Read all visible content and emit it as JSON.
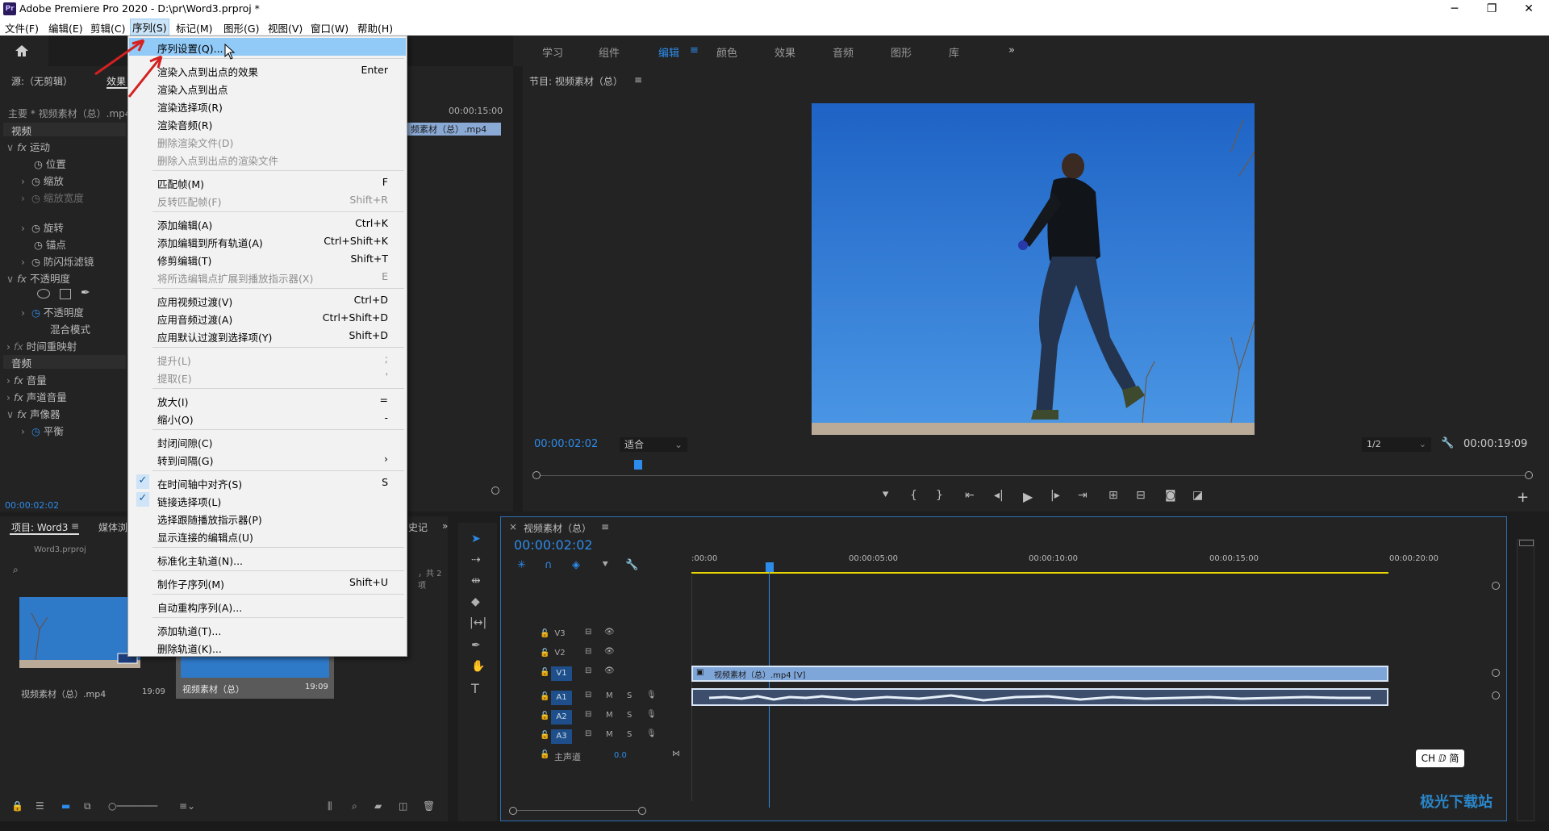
{
  "window": {
    "title": "Adobe Premiere Pro 2020 - D:\\pr\\Word3.prproj *",
    "icon": "Pr",
    "min": "─",
    "max": "❐",
    "close": "✕"
  },
  "menubar": [
    "文件(F)",
    "编辑(E)",
    "剪辑(C)",
    "序列(S)",
    "标记(M)",
    "图形(G)",
    "视图(V)",
    "窗口(W)",
    "帮助(H)"
  ],
  "workspaces": {
    "items": [
      "学习",
      "组件",
      "编辑",
      "颜色",
      "效果",
      "音频",
      "图形",
      "库"
    ],
    "active": "编辑",
    "more": "»"
  },
  "source_tabs": {
    "source": "源:（无剪辑）",
    "effects": "效果"
  },
  "effect_controls": {
    "clip": "主要 * 视频素材（总）.mp4",
    "time_ruler": "00:00:15:00",
    "clip_bar": "频素材（总）.mp4",
    "video_header": "视频",
    "rows": [
      {
        "label": "运动",
        "type": "fx"
      },
      {
        "label": "位置",
        "type": "prop"
      },
      {
        "label": "缩放",
        "type": "prop"
      },
      {
        "label": "缩放宽度",
        "type": "prop-dis"
      },
      {
        "label": "旋转",
        "type": "prop"
      },
      {
        "label": "锚点",
        "type": "prop"
      },
      {
        "label": "防闪烁滤镜",
        "type": "prop"
      },
      {
        "label": "不透明度",
        "type": "fx"
      },
      {
        "label": "不透明度",
        "type": "prop"
      },
      {
        "label": "混合模式",
        "type": "prop"
      },
      {
        "label": "时间重映射",
        "type": "fx"
      }
    ],
    "audio_header": "音频",
    "audio_rows": [
      {
        "label": "音量",
        "type": "fx"
      },
      {
        "label": "声道音量",
        "type": "fx"
      },
      {
        "label": "声像器",
        "type": "fx"
      },
      {
        "label": "平衡",
        "type": "prop"
      }
    ],
    "timecode": "00:00:02:02"
  },
  "sequence_menu": [
    {
      "label": "序列设置(Q)...",
      "shortcut": "",
      "state": "highlight"
    },
    {
      "label": "渲染入点到出点的效果",
      "shortcut": "Enter",
      "state": "normal",
      "sep_before": true
    },
    {
      "label": "渲染入点到出点",
      "shortcut": "",
      "state": "normal"
    },
    {
      "label": "渲染选择项(R)",
      "shortcut": "",
      "state": "normal"
    },
    {
      "label": "渲染音频(R)",
      "shortcut": "",
      "state": "normal"
    },
    {
      "label": "删除渲染文件(D)",
      "shortcut": "",
      "state": "disabled"
    },
    {
      "label": "删除入点到出点的渲染文件",
      "shortcut": "",
      "state": "disabled"
    },
    {
      "label": "匹配帧(M)",
      "shortcut": "F",
      "state": "normal",
      "sep_before": true
    },
    {
      "label": "反转匹配帧(F)",
      "shortcut": "Shift+R",
      "state": "disabled"
    },
    {
      "label": "添加编辑(A)",
      "shortcut": "Ctrl+K",
      "state": "normal",
      "sep_before": true
    },
    {
      "label": "添加编辑到所有轨道(A)",
      "shortcut": "Ctrl+Shift+K",
      "state": "normal"
    },
    {
      "label": "修剪编辑(T)",
      "shortcut": "Shift+T",
      "state": "normal"
    },
    {
      "label": "将所选编辑点扩展到播放指示器(X)",
      "shortcut": "E",
      "state": "disabled"
    },
    {
      "label": "应用视频过渡(V)",
      "shortcut": "Ctrl+D",
      "state": "normal",
      "sep_before": true
    },
    {
      "label": "应用音频过渡(A)",
      "shortcut": "Ctrl+Shift+D",
      "state": "normal"
    },
    {
      "label": "应用默认过渡到选择项(Y)",
      "shortcut": "Shift+D",
      "state": "normal"
    },
    {
      "label": "提升(L)",
      "shortcut": ";",
      "state": "disabled",
      "sep_before": true
    },
    {
      "label": "提取(E)",
      "shortcut": "'",
      "state": "disabled"
    },
    {
      "label": "放大(I)",
      "shortcut": "=",
      "state": "normal",
      "sep_before": true
    },
    {
      "label": "缩小(O)",
      "shortcut": "-",
      "state": "normal"
    },
    {
      "label": "封闭间隙(C)",
      "shortcut": "",
      "state": "normal",
      "sep_before": true
    },
    {
      "label": "转到间隔(G)",
      "shortcut": "›",
      "state": "normal"
    },
    {
      "label": "在时间轴中对齐(S)",
      "shortcut": "S",
      "state": "checked",
      "sep_before": true
    },
    {
      "label": "链接选择项(L)",
      "shortcut": "",
      "state": "checked"
    },
    {
      "label": "选择跟随播放指示器(P)",
      "shortcut": "",
      "state": "normal"
    },
    {
      "label": "显示连接的编辑点(U)",
      "shortcut": "",
      "state": "normal"
    },
    {
      "label": "标准化主轨道(N)...",
      "shortcut": "",
      "state": "normal",
      "sep_before": true
    },
    {
      "label": "制作子序列(M)",
      "shortcut": "Shift+U",
      "state": "normal",
      "sep_before": true
    },
    {
      "label": "自动重构序列(A)...",
      "shortcut": "",
      "state": "normal",
      "sep_before": true
    },
    {
      "label": "添加轨道(T)...",
      "shortcut": "",
      "state": "normal",
      "sep_before": true
    },
    {
      "label": "删除轨道(K)...",
      "shortcut": "",
      "state": "normal"
    }
  ],
  "program": {
    "title": "节目: 视频素材（总）",
    "timecode": "00:00:02:02",
    "fit": "适合",
    "resolution": "1/2",
    "duration": "00:00:19:09"
  },
  "project": {
    "tab": "项目: Word3",
    "tab2": "媒体浏",
    "tab3": "史记",
    "file": "Word3.prproj",
    "count": "，共 2 项",
    "items": [
      {
        "name": "视频素材（总）.mp4",
        "dur": "19:09"
      },
      {
        "name": "视频素材（总）",
        "dur": "19:09"
      }
    ]
  },
  "timeline": {
    "tab": "视频素材（总）",
    "timecode": "00:00:02:02",
    "ruler": [
      ":00:00",
      "00:00:05:00",
      "00:00:10:00",
      "00:00:15:00",
      "00:00:20:00"
    ],
    "tracks": [
      {
        "name": "V3",
        "type": "video"
      },
      {
        "name": "V2",
        "type": "video"
      },
      {
        "name": "V1",
        "type": "video",
        "active": true
      },
      {
        "name": "A1",
        "type": "audio"
      },
      {
        "name": "A2",
        "type": "audio"
      },
      {
        "name": "A3",
        "type": "audio"
      }
    ],
    "master": {
      "label": "主声道",
      "value": "0.0"
    },
    "clip_v": "视频素材（总）.mp4 [V]",
    "ime": "CH ⅅ 简"
  },
  "watermark": "极光下载站"
}
